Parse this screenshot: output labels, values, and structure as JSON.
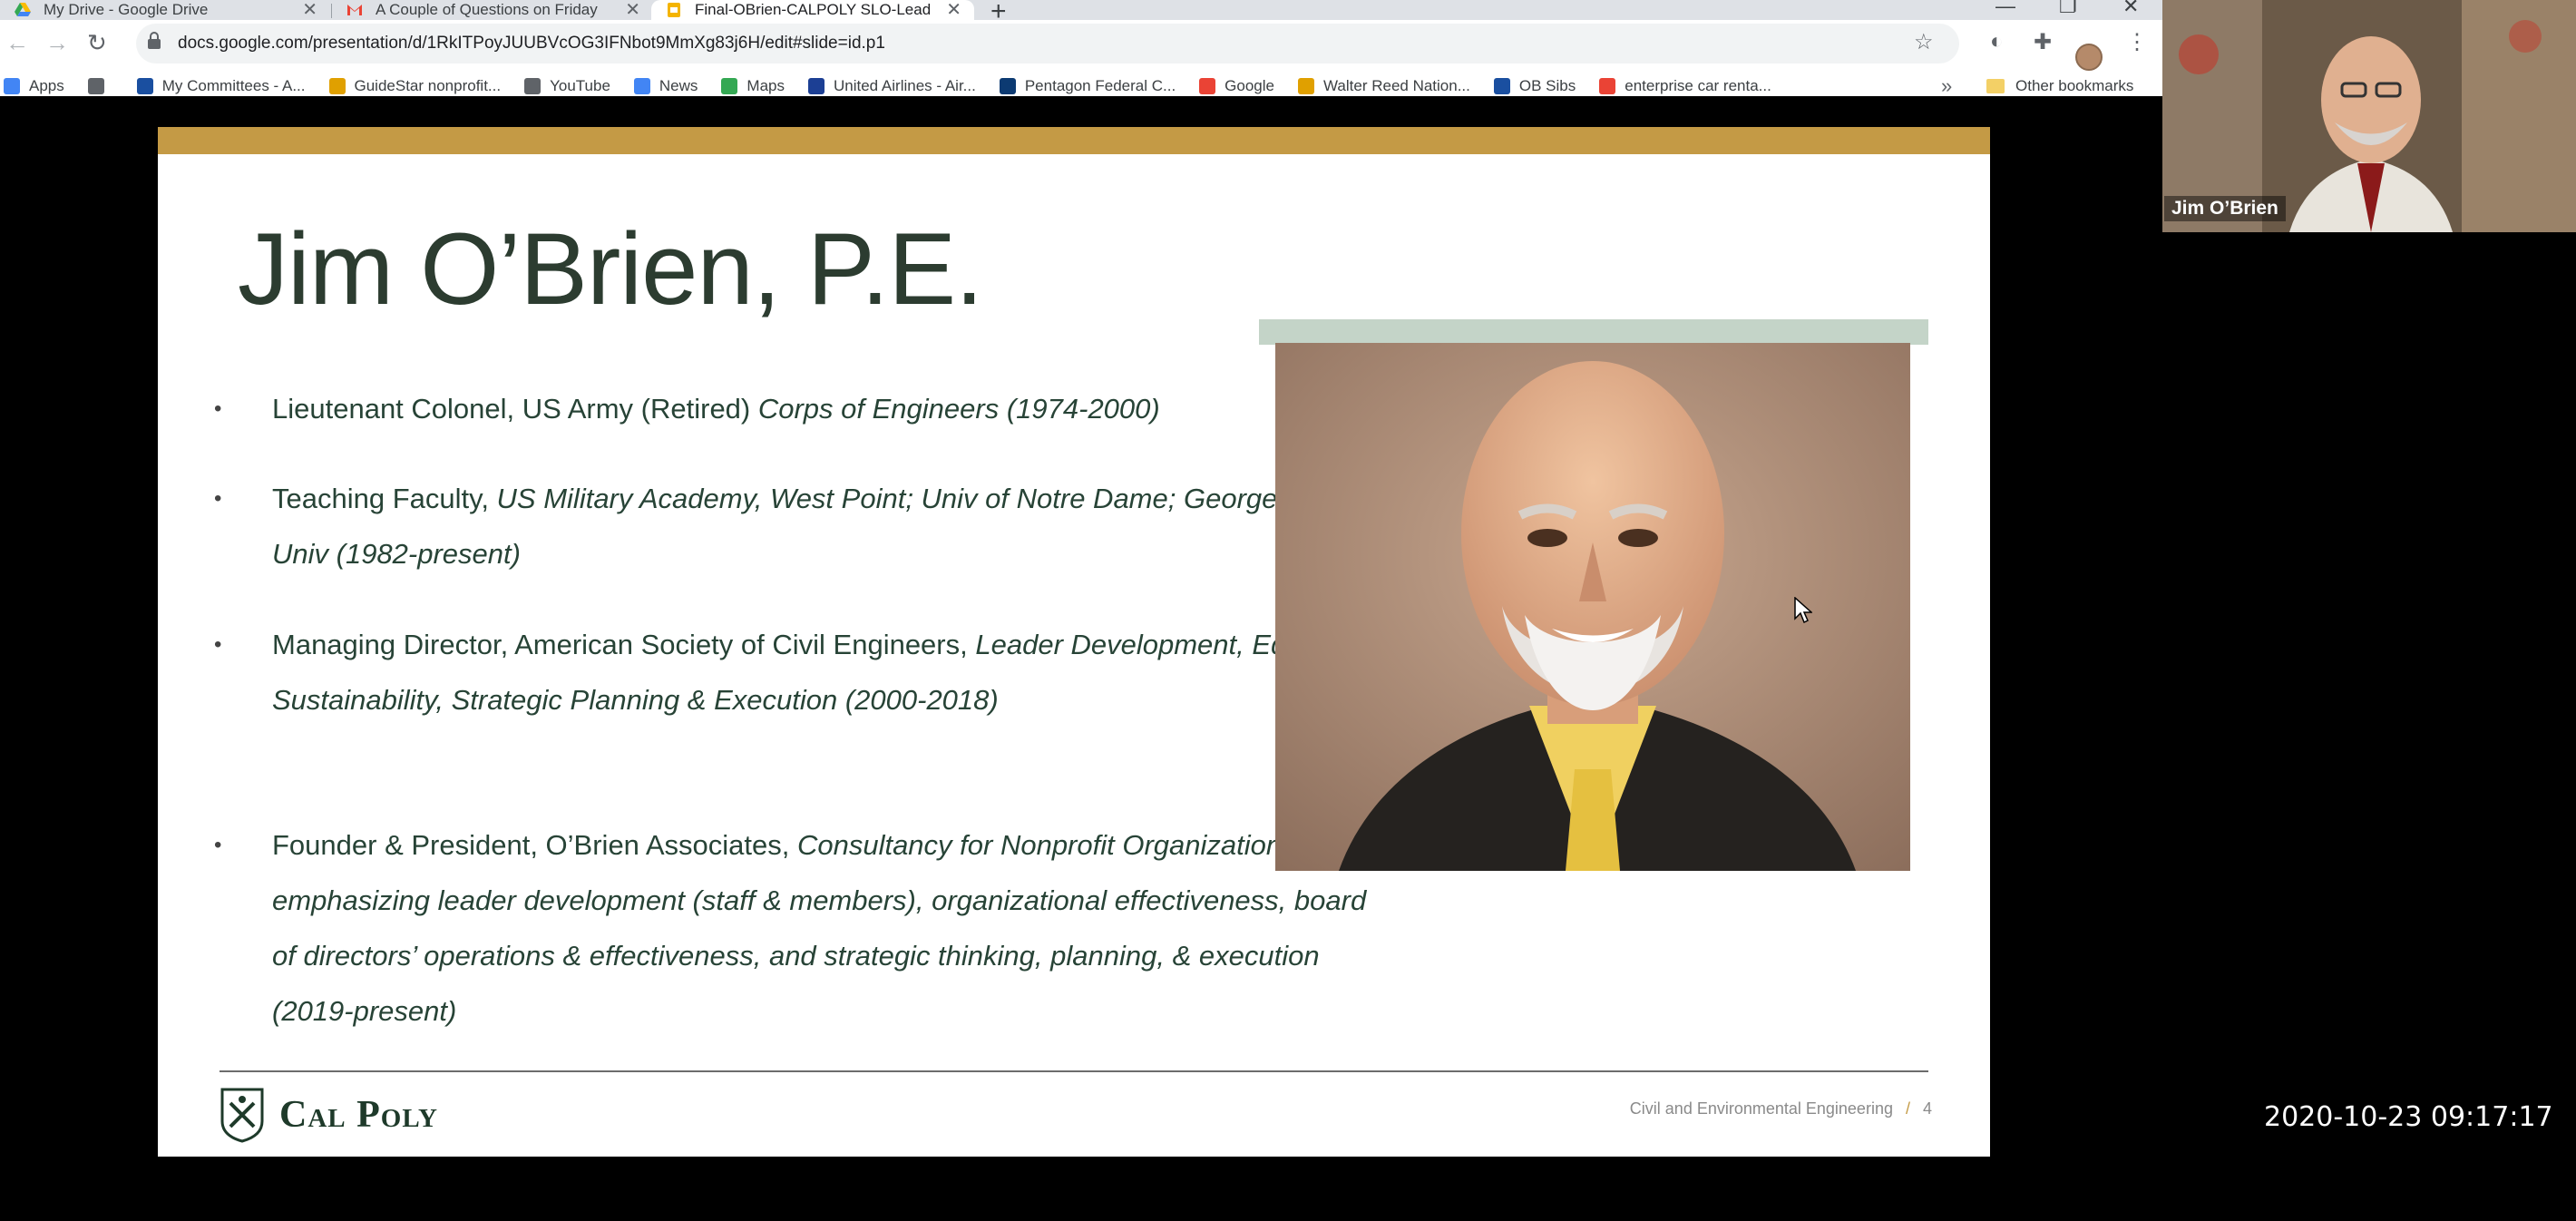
{
  "tabs": [
    {
      "title": "My Drive - Google Drive",
      "close": "✕"
    },
    {
      "title": "A Couple of Questions on Friday",
      "close": "✕"
    },
    {
      "title": "Final-OBrien-CALPOLY SLO-Lead",
      "close": "✕"
    }
  ],
  "new_tab": "+",
  "window_controls": {
    "minimize": "—",
    "restore": "❐",
    "close": "✕"
  },
  "nav": {
    "back": "←",
    "forward": "→",
    "reload": "↻"
  },
  "url": "docs.google.com/presentation/d/1RkITPoyJUUBVcOG3IFNbot9MmXg83j6H/edit#slide=id.p1",
  "toolbar_icons": {
    "star": "☆",
    "extension1": "◐",
    "puzzle": "✚",
    "menu": "⋮"
  },
  "bookmarks": [
    {
      "label": "Apps",
      "color": "#4285f4"
    },
    {
      "label": "",
      "color": "#5f6368"
    },
    {
      "label": "My Committees - A...",
      "color": "#1a4fa0"
    },
    {
      "label": "GuideStar nonprofit...",
      "color": "#e0a000"
    },
    {
      "label": "YouTube",
      "color": "#5f6368"
    },
    {
      "label": "News",
      "color": "#4285f4"
    },
    {
      "label": "Maps",
      "color": "#34a853"
    },
    {
      "label": "United Airlines - Air...",
      "color": "#1c3f94"
    },
    {
      "label": "Pentagon Federal C...",
      "color": "#0c3a72"
    },
    {
      "label": "Google",
      "color": "#ea4335"
    },
    {
      "label": "Walter Reed Nation...",
      "color": "#e0a000"
    },
    {
      "label": "OB Sibs",
      "color": "#1a4fa0"
    },
    {
      "label": "enterprise car renta...",
      "color": "#ea4335"
    }
  ],
  "bookmarks_overflow": "»",
  "other_bookmarks": "Other bookmarks",
  "slide": {
    "title": "Jim O’Brien, P.E.",
    "bullets": [
      {
        "text": "Lieutenant Colonel, US Army (Retired)  ",
        "italic": "Corps of Engineers (1974-2000)"
      },
      {
        "text": "Teaching Faculty, ",
        "italic": "US Military Academy, West Point; Univ of Notre Dame; George Mason Univ (1982-present)"
      },
      {
        "text": "Managing Director, American Society of Civil Engineers, ",
        "italic": "Leader Development, Education, Sustainability, Strategic Planning & Execution (2000-2018)"
      },
      {
        "text": "Founder & President, O’Brien Associates, ",
        "italic": "Consultancy for Nonprofit Organizations emphasizing leader development (staff & members), organizational effectiveness, board of directors’ operations & effectiveness, and strategic thinking, planning, & execution (2019-present)"
      }
    ],
    "bullet_symbol": "•",
    "logo_text": "Cal Poly",
    "footer_text": "Civil and Environmental Engineering",
    "footer_sep": "/",
    "page_number": "4",
    "accent_color": "#c49a45"
  },
  "video": {
    "participant_name": "Jim O’Brien"
  },
  "timestamp": "2020-10-23 09:17:17"
}
